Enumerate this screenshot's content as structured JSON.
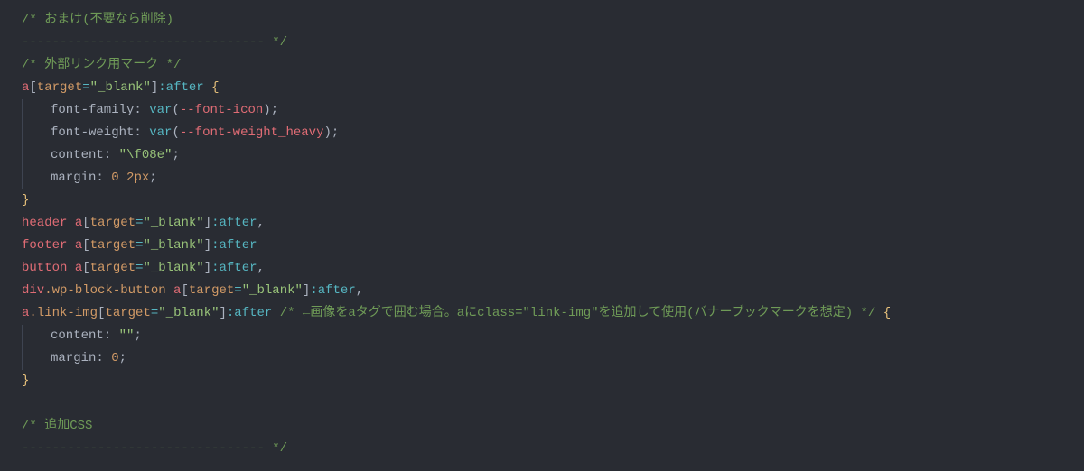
{
  "code": {
    "lines": [
      {
        "type": "comment",
        "text": "/* おまけ(不要なら削除)"
      },
      {
        "type": "comment",
        "text": "-------------------------------- */"
      },
      {
        "type": "comment",
        "text": "/* 外部リンク用マーク */"
      },
      {
        "type": "selector-open",
        "tokens": [
          {
            "t": "tag",
            "v": "a"
          },
          {
            "t": "bracket",
            "v": "["
          },
          {
            "t": "attr",
            "v": "target"
          },
          {
            "t": "op",
            "v": "="
          },
          {
            "t": "string",
            "v": "\"_blank\""
          },
          {
            "t": "bracket",
            "v": "]"
          },
          {
            "t": "pseudo",
            "v": ":after"
          },
          {
            "t": "text",
            "v": " "
          },
          {
            "t": "brace",
            "v": "{"
          }
        ]
      },
      {
        "type": "decl",
        "tokens": [
          {
            "t": "prop",
            "v": "font-family"
          },
          {
            "t": "bracket",
            "v": ": "
          },
          {
            "t": "func",
            "v": "var"
          },
          {
            "t": "bracket",
            "v": "("
          },
          {
            "t": "var",
            "v": "--font-icon"
          },
          {
            "t": "bracket",
            "v": ")"
          },
          {
            "t": "bracket",
            "v": ";"
          }
        ]
      },
      {
        "type": "decl",
        "tokens": [
          {
            "t": "prop",
            "v": "font-weight"
          },
          {
            "t": "bracket",
            "v": ": "
          },
          {
            "t": "func",
            "v": "var"
          },
          {
            "t": "bracket",
            "v": "("
          },
          {
            "t": "var",
            "v": "--font-weight_heavy"
          },
          {
            "t": "bracket",
            "v": ")"
          },
          {
            "t": "bracket",
            "v": ";"
          }
        ]
      },
      {
        "type": "decl",
        "tokens": [
          {
            "t": "prop",
            "v": "content"
          },
          {
            "t": "bracket",
            "v": ": "
          },
          {
            "t": "string",
            "v": "\"\\f08e\""
          },
          {
            "t": "bracket",
            "v": ";"
          }
        ]
      },
      {
        "type": "decl",
        "tokens": [
          {
            "t": "prop",
            "v": "margin"
          },
          {
            "t": "bracket",
            "v": ": "
          },
          {
            "t": "num",
            "v": "0"
          },
          {
            "t": "text",
            "v": " "
          },
          {
            "t": "num",
            "v": "2px"
          },
          {
            "t": "bracket",
            "v": ";"
          }
        ]
      },
      {
        "type": "close",
        "tokens": [
          {
            "t": "brace",
            "v": "}"
          }
        ]
      },
      {
        "type": "selector",
        "tokens": [
          {
            "t": "tag",
            "v": "header"
          },
          {
            "t": "text",
            "v": " "
          },
          {
            "t": "tag",
            "v": "a"
          },
          {
            "t": "bracket",
            "v": "["
          },
          {
            "t": "attr",
            "v": "target"
          },
          {
            "t": "op",
            "v": "="
          },
          {
            "t": "string",
            "v": "\"_blank\""
          },
          {
            "t": "bracket",
            "v": "]"
          },
          {
            "t": "pseudo",
            "v": ":after"
          },
          {
            "t": "bracket",
            "v": ","
          }
        ]
      },
      {
        "type": "selector",
        "tokens": [
          {
            "t": "tag",
            "v": "footer"
          },
          {
            "t": "text",
            "v": " "
          },
          {
            "t": "tag",
            "v": "a"
          },
          {
            "t": "bracket",
            "v": "["
          },
          {
            "t": "attr",
            "v": "target"
          },
          {
            "t": "op",
            "v": "="
          },
          {
            "t": "string",
            "v": "\"_blank\""
          },
          {
            "t": "bracket",
            "v": "]"
          },
          {
            "t": "pseudo",
            "v": ":after"
          }
        ]
      },
      {
        "type": "selector",
        "tokens": [
          {
            "t": "tag",
            "v": "button"
          },
          {
            "t": "text",
            "v": " "
          },
          {
            "t": "tag",
            "v": "a"
          },
          {
            "t": "bracket",
            "v": "["
          },
          {
            "t": "attr",
            "v": "target"
          },
          {
            "t": "op",
            "v": "="
          },
          {
            "t": "string",
            "v": "\"_blank\""
          },
          {
            "t": "bracket",
            "v": "]"
          },
          {
            "t": "pseudo",
            "v": ":after"
          },
          {
            "t": "bracket",
            "v": ","
          }
        ]
      },
      {
        "type": "selector",
        "tokens": [
          {
            "t": "tag",
            "v": "div"
          },
          {
            "t": "class",
            "v": ".wp-block-button"
          },
          {
            "t": "text",
            "v": " "
          },
          {
            "t": "tag",
            "v": "a"
          },
          {
            "t": "bracket",
            "v": "["
          },
          {
            "t": "attr",
            "v": "target"
          },
          {
            "t": "op",
            "v": "="
          },
          {
            "t": "string",
            "v": "\"_blank\""
          },
          {
            "t": "bracket",
            "v": "]"
          },
          {
            "t": "pseudo",
            "v": ":after"
          },
          {
            "t": "bracket",
            "v": ","
          }
        ]
      },
      {
        "type": "selector-open",
        "tokens": [
          {
            "t": "tag",
            "v": "a"
          },
          {
            "t": "class",
            "v": ".link-img"
          },
          {
            "t": "bracket",
            "v": "["
          },
          {
            "t": "attr",
            "v": "target"
          },
          {
            "t": "op",
            "v": "="
          },
          {
            "t": "string",
            "v": "\"_blank\""
          },
          {
            "t": "bracket",
            "v": "]"
          },
          {
            "t": "pseudo",
            "v": ":after"
          },
          {
            "t": "text",
            "v": " "
          },
          {
            "t": "comment",
            "v": "/* ←画像をaタグで囲む場合。aにclass=\"link-img\"を追加して使用(バナーブックマークを想定) */"
          },
          {
            "t": "text",
            "v": " "
          },
          {
            "t": "brace",
            "v": "{"
          }
        ]
      },
      {
        "type": "decl",
        "tokens": [
          {
            "t": "prop",
            "v": "content"
          },
          {
            "t": "bracket",
            "v": ": "
          },
          {
            "t": "string",
            "v": "\"\""
          },
          {
            "t": "bracket",
            "v": ";"
          }
        ]
      },
      {
        "type": "decl",
        "tokens": [
          {
            "t": "prop",
            "v": "margin"
          },
          {
            "t": "bracket",
            "v": ": "
          },
          {
            "t": "num",
            "v": "0"
          },
          {
            "t": "bracket",
            "v": ";"
          }
        ]
      },
      {
        "type": "close",
        "tokens": [
          {
            "t": "brace",
            "v": "}"
          }
        ]
      },
      {
        "type": "blank"
      },
      {
        "type": "comment",
        "text": "/* 追加CSS"
      },
      {
        "type": "comment",
        "text": "-------------------------------- */"
      }
    ]
  },
  "colors": {
    "background": "#292c33",
    "comment": "#6f9b57",
    "tag": "#e06c75",
    "attr": "#d19a66",
    "operator": "#56b6c2",
    "string": "#98c379",
    "pseudo": "#56b6c2",
    "brace": "#e6c07b",
    "default": "#abb2bf",
    "func": "#56b6c2",
    "number": "#d19a66"
  }
}
